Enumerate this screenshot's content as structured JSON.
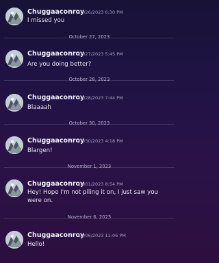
{
  "messages": [
    {
      "author": "Chuggaaconroy",
      "time": "10/26/2023 6:30 PM",
      "text": "I missed you"
    },
    {
      "author": "Chuggaaconroy",
      "time": "10/27/2023 5:45 PM",
      "text": "Are you doing better?"
    },
    {
      "author": "Chuggaaconroy",
      "time": "10/28/2023 7:44 PM",
      "text": "Blaaaah"
    },
    {
      "author": "Chuggaaconroy",
      "time": "10/30/2023 4:18 PM",
      "text": "Blargen!"
    },
    {
      "author": "Chuggaaconroy",
      "time": "11/01/2023 8:54 PM",
      "text": "Hey! Hope I'm not piling it on, I just saw you were on."
    },
    {
      "author": "Chuggaaconroy",
      "time": "11/06/2023 11:06 PM",
      "text": "Hello!"
    }
  ],
  "dividers": [
    "October 27, 2023",
    "October 28, 2023",
    "October 30, 2023",
    "November 1, 2023",
    "November 6, 2023"
  ]
}
